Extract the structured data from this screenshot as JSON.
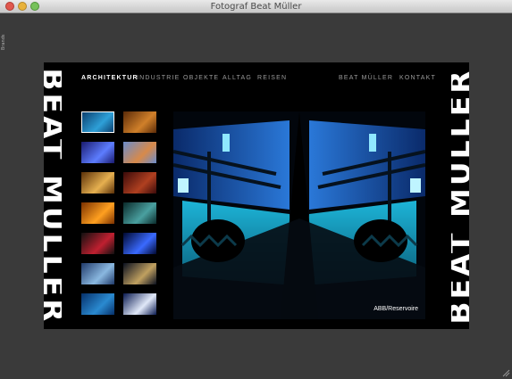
{
  "window": {
    "title": "Fotograf Beat Müller",
    "side_label": "Brands"
  },
  "brand": {
    "text": "BEAT MÜLLER"
  },
  "nav": {
    "items": [
      {
        "label": "ARCHITEKTUR",
        "active": true
      },
      {
        "label": "INDUSTRIE",
        "active": false
      },
      {
        "label": "OBJEKTE",
        "active": false
      },
      {
        "label": "ALLTAG",
        "active": false
      },
      {
        "label": "REISEN",
        "active": false
      }
    ],
    "right": [
      {
        "label": "BEAT MÜLLER"
      },
      {
        "label": "KONTAKT"
      }
    ]
  },
  "gallery": {
    "thumbs": [
      {
        "name": "thumb-blue-stairs",
        "selected": true,
        "colors": [
          "#0b3f6e",
          "#2ea0d8"
        ]
      },
      {
        "name": "thumb-warm-interior",
        "selected": false,
        "colors": [
          "#5a2a08",
          "#d0802a"
        ]
      },
      {
        "name": "thumb-blue-facade",
        "selected": false,
        "colors": [
          "#1a1a6e",
          "#5d7dff"
        ]
      },
      {
        "name": "thumb-sky-building",
        "selected": false,
        "colors": [
          "#6a8ccc",
          "#d88a4a"
        ]
      },
      {
        "name": "thumb-gold-room",
        "selected": false,
        "colors": [
          "#5a3008",
          "#e6b050"
        ]
      },
      {
        "name": "thumb-red-interior",
        "selected": false,
        "colors": [
          "#3a0a0a",
          "#b04020"
        ]
      },
      {
        "name": "thumb-orange-windows",
        "selected": false,
        "colors": [
          "#7a3000",
          "#ffa020"
        ]
      },
      {
        "name": "thumb-teal-glass",
        "selected": false,
        "colors": [
          "#0a2a2a",
          "#4aa0a0"
        ]
      },
      {
        "name": "thumb-colored-lights",
        "selected": false,
        "colors": [
          "#101010",
          "#c02030"
        ]
      },
      {
        "name": "thumb-blue-curves",
        "selected": false,
        "colors": [
          "#000830",
          "#3a6aff"
        ]
      },
      {
        "name": "thumb-glass-tower",
        "selected": false,
        "colors": [
          "#203a6a",
          "#8ab8e0"
        ]
      },
      {
        "name": "thumb-night-grid",
        "selected": false,
        "colors": [
          "#0a1020",
          "#c0a060"
        ]
      },
      {
        "name": "thumb-blue-panels",
        "selected": false,
        "colors": [
          "#06306a",
          "#2a8ad0"
        ]
      },
      {
        "name": "thumb-white-angle",
        "selected": false,
        "colors": [
          "#0a1a50",
          "#e0e8f8"
        ]
      }
    ]
  },
  "photo": {
    "caption": "ABB/Reservoire"
  }
}
